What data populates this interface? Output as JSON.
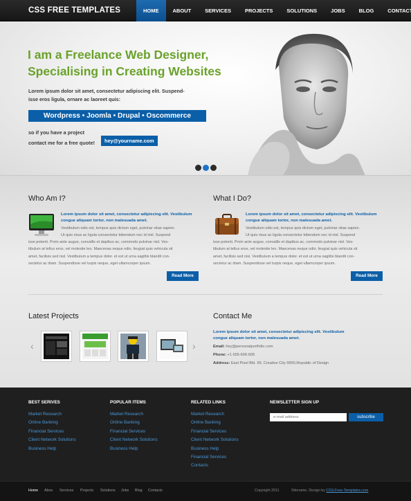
{
  "header": {
    "logo": "CSS FREE TEMPLATES",
    "nav": [
      "HOME",
      "ABOUT",
      "SERVICES",
      "PROJECTS",
      "SOLUTIONS",
      "JOBS",
      "BLOG",
      "CONTACTS"
    ],
    "active_nav": "HOME"
  },
  "hero": {
    "title_line1": "I am a Freelance Web Designer,",
    "title_line2": "Specialising in Creating Websites",
    "desc_line1": "Lorem ipsum dolor sit amet, consectetur adipiscing elit. Suspend-",
    "desc_line2": "isse eros ligula, ornare ac laoreet quis:",
    "cms_list": "Wordpress • Joomla • Drupal • Oscommerce",
    "small_line1": "so if you have a project",
    "small_line2": "contact me for a free quote!",
    "email": "hey@yourname.com"
  },
  "who": {
    "title": "Who Am I?",
    "icon": "monitor-icon",
    "lead_line1": "Lorem ipsum dolor sit amet, consectetur adipiscing elit. Vestibulum",
    "lead_line2": "congue aliquam tortor, non malesuada amet.",
    "text_line1": "Vestibulum odio est, tempus quis dictum eget, pulvinar vitae sapien.",
    "text_line2": "Ut quis risus ac ligula consectetur bibendum nec id nisl. Suspend",
    "text_line3": "isse potenti. Proin ante augue, convallis et dapibus ac, commodo pulvinar nisl. Ves-",
    "text_line4": "tibulum at tellus eros, vel molestie leo. Maecenas neque odio, feugiat quis vehicula sit",
    "text_line5": "amet, facilisis sed nisl. Vestibulum a tempus dolor. et est ut urna sagittis blandit con-",
    "text_line6": "sectetur ac diam. Suspendisse vel turpis neque, eget ullamcorper ipsum.",
    "button": "Read More"
  },
  "what": {
    "title": "What I Do?",
    "icon": "briefcase-icon",
    "lead_line1": "Lorem ipsum dolor sit amet, consectetur adipiscing elit. Vestibulum",
    "lead_line2": "congue aliquam tortor, non malesuada amet.",
    "text_line1": "Vestibulum odio est, tempus quis dictum eget, pulvinar vitae sapien.",
    "text_line2": "Ut quis risus ac ligula consectetur bibendum nec id nisl. Suspend",
    "text_line3": "isse potenti. Proin ante augue, convallis et dapibus ac, commodo pulvinar nisl. Ves-",
    "text_line4": "tibulum at tellus eros, vel molestie leo. Maecenas neque odio, feugiat quis vehicula sit",
    "text_line5": "amet, facilisis sed nisl. Vestibulum a tempus dolor. et est ut urna sagittis blandit con-",
    "text_line6": "sectetur ac diam. Suspendisse vel turpis neque, eget ullamcorper ipsum.",
    "button": "Read More"
  },
  "projects": {
    "title": "Latest Projects",
    "arrow_left": "‹",
    "arrow_right": "›"
  },
  "contact": {
    "title": "Contact Me",
    "lead_line1": "Lorem ipsum dolor sit amet, consectetur adipiscing elit. Vestibulum",
    "lead_line2": "congue aliquam tortor, non malesuada amet.",
    "email_label": "Email:",
    "email_value": "hey@personalportfolio.com",
    "phone_label": "Phone:",
    "phone_value": "+1 655-606-605",
    "address_label": "Address:",
    "address_value": "East Pixel Bld. 99, Creative City 9000,Republic of Design"
  },
  "footer": {
    "col1_title": "BEST SERIVES",
    "col1_links": [
      "Market Research",
      "Online Banking",
      "Financial Services",
      "Client Network Solutions",
      "Business Help"
    ],
    "col2_title": "POPULAR ITEMS",
    "col2_links": [
      "Market Research",
      "Online Banking",
      "Financial Services",
      "Client Network Solutions",
      "Business Help"
    ],
    "col3_title": "RELATED LINKS",
    "col3_links": [
      "Market Research",
      "Online Banking",
      "Financial Services",
      "Client Network Solutions",
      "Business Help",
      "Financial Services",
      "Contacts"
    ],
    "newsletter_title": "NEWSLETTER SIGN UP",
    "newsletter_placeholder": "e-mail address",
    "subscribe": "subscribe"
  },
  "bottom": {
    "links": [
      "Home",
      "Abou",
      "Services",
      "Projects",
      "Solutions",
      "Jobs",
      "Blog",
      "Contacts"
    ],
    "copyright": "Copyright 2011",
    "sitename": "Sitename. Design by",
    "credit": "CSS-Free-Templates.com"
  },
  "colors": {
    "accent_blue": "#0b5fa8",
    "accent_green": "#6aa22a",
    "footer_bg": "#1f1f1f"
  }
}
